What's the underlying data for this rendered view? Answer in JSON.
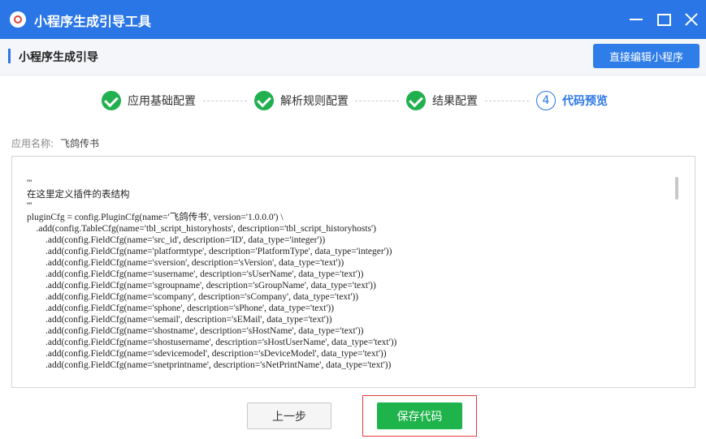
{
  "window": {
    "title": "小程序生成引导工具",
    "controls": {
      "minimize": "minimize-icon",
      "maximize": "maximize-icon",
      "close": "close-icon"
    }
  },
  "header": {
    "title": "小程序生成引导",
    "edit_button": "直接编辑小程序"
  },
  "steps": [
    {
      "label": "应用基础配置",
      "status": "done"
    },
    {
      "label": "解析规则配置",
      "status": "done"
    },
    {
      "label": "结果配置",
      "status": "done"
    },
    {
      "number": "4",
      "label": "代码预览",
      "status": "active"
    }
  ],
  "app_name": {
    "label": "应用名称:",
    "value": "飞鸽传书"
  },
  "code": {
    "lines": [
      "'''",
      "在这里定义插件的表结构",
      "'''",
      "pluginCfg = config.PluginCfg(name='飞鸽传书', version='1.0.0.0') \\",
      "    .add(config.TableCfg(name='tbl_script_historyhosts', description='tbl_script_historyhosts')",
      "        .add(config.FieldCfg(name='src_id', description='ID', data_type='integer'))",
      "        .add(config.FieldCfg(name='platformtype', description='PlatformType', data_type='integer'))",
      "        .add(config.FieldCfg(name='sversion', description='sVersion', data_type='text'))",
      "        .add(config.FieldCfg(name='susername', description='sUserName', data_type='text'))",
      "        .add(config.FieldCfg(name='sgroupname', description='sGroupName', data_type='text'))",
      "        .add(config.FieldCfg(name='scompany', description='sCompany', data_type='text'))",
      "        .add(config.FieldCfg(name='sphone', description='sPhone', data_type='text'))",
      "        .add(config.FieldCfg(name='semail', description='sEMail', data_type='text'))",
      "        .add(config.FieldCfg(name='shostname', description='sHostName', data_type='text'))",
      "        .add(config.FieldCfg(name='shostusername', description='sHostUserName', data_type='text'))",
      "        .add(config.FieldCfg(name='sdevicemodel', description='sDeviceModel', data_type='text'))",
      "        .add(config.FieldCfg(name='snetprintname', description='sNetPrintName', data_type='text'))"
    ]
  },
  "footer": {
    "prev_button": "上一步",
    "save_button": "保存代码"
  },
  "colors": {
    "titlebar": "#2a76e6",
    "accent": "#2a76e6",
    "done": "#21b04f",
    "save": "#1eb34b",
    "highlight_frame": "#e23b3b"
  }
}
